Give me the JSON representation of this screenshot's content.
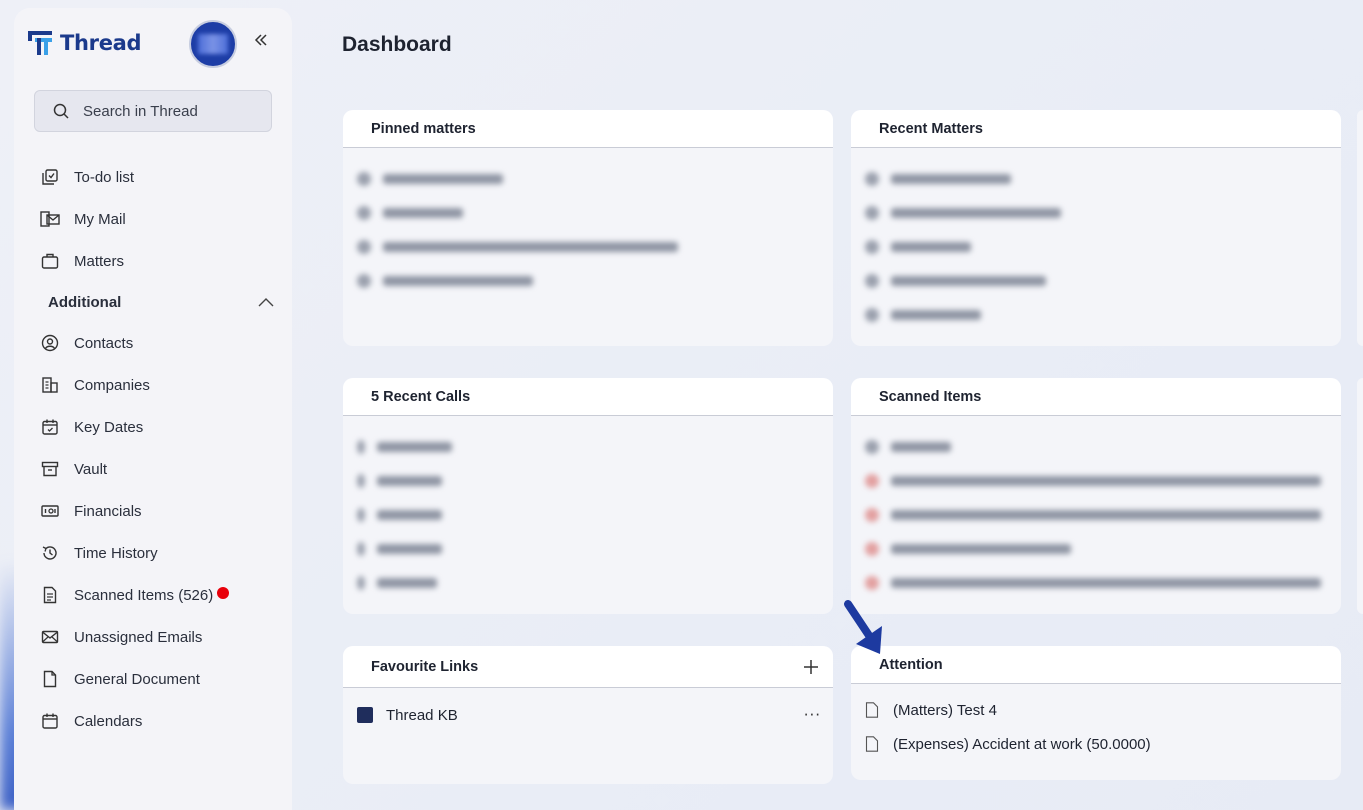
{
  "app": {
    "name": "Thread"
  },
  "search": {
    "placeholder": "Search in Thread"
  },
  "nav": {
    "items": [
      {
        "label": "To-do list",
        "icon": "todo-icon"
      },
      {
        "label": "My Mail",
        "icon": "mail-icon"
      },
      {
        "label": "Matters",
        "icon": "briefcase-icon"
      }
    ],
    "section_label": "Additional",
    "additional": [
      {
        "label": "Contacts",
        "icon": "contact-icon"
      },
      {
        "label": "Companies",
        "icon": "building-icon"
      },
      {
        "label": "Key Dates",
        "icon": "calendar-icon"
      },
      {
        "label": "Vault",
        "icon": "archive-icon"
      },
      {
        "label": "Financials",
        "icon": "money-icon"
      },
      {
        "label": "Time History",
        "icon": "history-icon"
      },
      {
        "label": "Scanned Items (526)",
        "icon": "document-icon"
      },
      {
        "label": "Unassigned Emails",
        "icon": "envelope-icon"
      },
      {
        "label": "General Document",
        "icon": "file-icon"
      },
      {
        "label": "Calendars",
        "icon": "calendar-icon"
      }
    ]
  },
  "page": {
    "title": "Dashboard"
  },
  "cards": {
    "pinned": {
      "title": "Pinned matters"
    },
    "recent_matters": {
      "title": "Recent Matters"
    },
    "recent_calls": {
      "title": "5 Recent Calls"
    },
    "scanned": {
      "title": "Scanned Items"
    },
    "favourites": {
      "title": "Favourite Links",
      "add_label": "+",
      "links": [
        {
          "label": "Thread KB",
          "more_label": "···"
        }
      ]
    },
    "attention": {
      "title": "Attention",
      "items": [
        {
          "label": "(Matters) Test 4"
        },
        {
          "label": "(Expenses) Accident at work (50.0000)"
        }
      ]
    }
  },
  "colors": {
    "brand": "#1b3a8c",
    "accent_blue": "#1d3da6",
    "alert_red": "#e8000b"
  }
}
